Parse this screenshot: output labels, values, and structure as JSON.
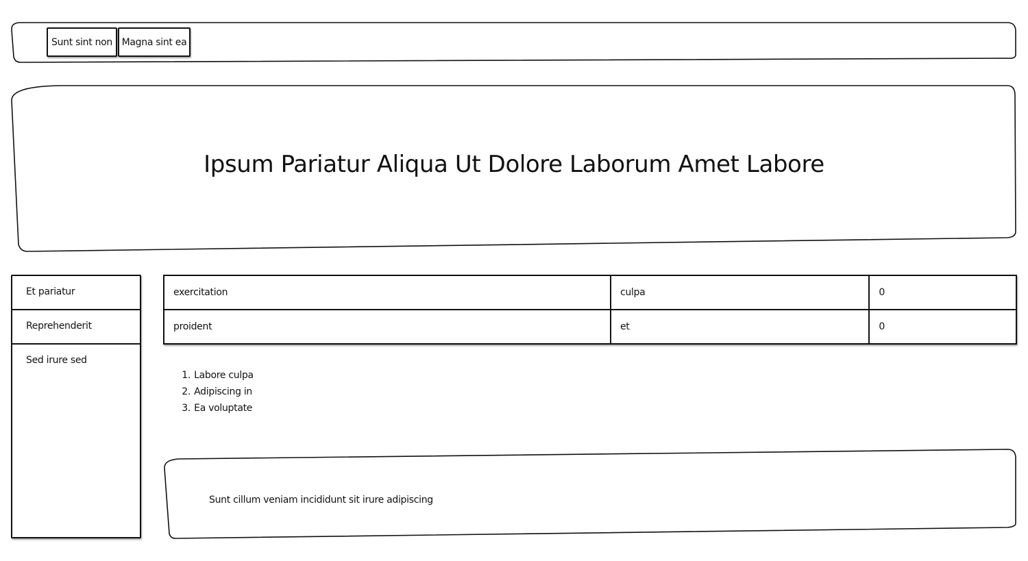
{
  "nav": {
    "tabs": [
      {
        "label": "Sunt sint non"
      },
      {
        "label": "Magna sint ea"
      }
    ]
  },
  "hero": {
    "title": "Ipsum Pariatur Aliqua Ut Dolore Laborum Amet Labore"
  },
  "sidebar": {
    "items": [
      {
        "label": "Et pariatur"
      },
      {
        "label": "Reprehenderit"
      },
      {
        "label": "Sed irure sed"
      }
    ]
  },
  "table": {
    "rows": [
      [
        "exercitation",
        "culpa",
        "0"
      ],
      [
        "proident",
        "et",
        "0"
      ]
    ]
  },
  "list": {
    "items": [
      {
        "number": "1.",
        "text": "Labore culpa"
      },
      {
        "number": "2.",
        "text": "Adipiscing in"
      },
      {
        "number": "3.",
        "text": "Ea voluptate"
      }
    ]
  },
  "footer": {
    "text": "Sunt cillum veniam incididunt sit irure adipiscing"
  }
}
